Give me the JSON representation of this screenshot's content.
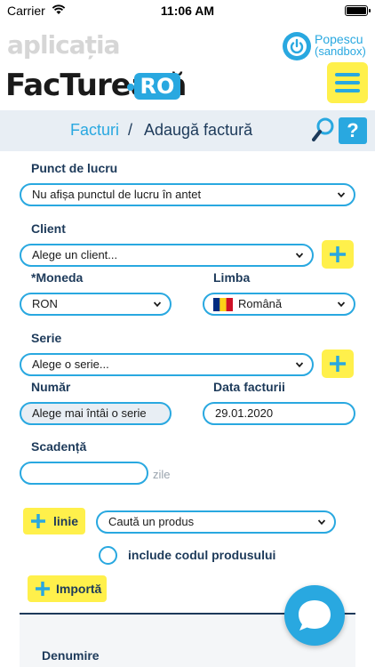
{
  "status_bar": {
    "carrier": "Carrier",
    "time": "11:06 AM"
  },
  "header": {
    "aplicatia": "aplicația",
    "brand": "FacTurează",
    "brand_suffix": "RO",
    "user_name": "Popescu",
    "user_env": "(sandbox)"
  },
  "breadcrumb": {
    "parent": "Facturi",
    "separator": "/",
    "current": "Adaugă factură",
    "help": "?"
  },
  "form": {
    "punct_label": "Punct de lucru",
    "punct_value": "Nu afișa punctul de lucru în antet",
    "client_label": "Client",
    "client_value": "Alege un client...",
    "moneda_label": "*Moneda",
    "moneda_value": "RON",
    "limba_label": "Limba",
    "limba_value": "Română",
    "serie_label": "Serie",
    "serie_value": "Alege o serie...",
    "numar_label": "Număr",
    "numar_value": "Alege mai întâi o serie",
    "data_label": "Data facturii",
    "data_value": "29.01.2020",
    "scadenta_label": "Scadență",
    "scadenta_value": "",
    "zile": "zile"
  },
  "products": {
    "add_line_label": "linie",
    "search_value": "Caută un produs",
    "include_code_label": "include codul produsului",
    "import_label": "Importă",
    "denumire_label": "Denumire"
  },
  "colors": {
    "accent": "#29a8e0",
    "highlight": "#fff04b",
    "text": "#1d3a5a"
  }
}
